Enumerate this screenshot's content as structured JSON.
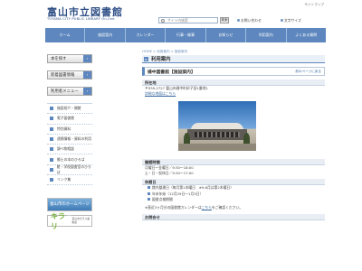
{
  "header": {
    "title": "富山市立図書館",
    "subtitle": "TOYAMA CITY PUBLIC LIBRARY On-line",
    "sitemap": "サイトマップ",
    "search_placeholder": "サイト内検索",
    "search_button": "検索",
    "link_contact": "お問い合わせ",
    "link_english": "文字サイズ"
  },
  "nav": [
    "ホーム",
    "施設案内",
    "カレンダー",
    "行事・催事",
    "お知らせ",
    "利用案内",
    "よくある質問"
  ],
  "breadcrumb": "HOME > 利用案内 > 施設案内",
  "sidebar": {
    "buttons": [
      {
        "label": "本を探す"
      },
      {
        "label": "新着図書情報"
      },
      {
        "label": "利用者メニュー"
      }
    ],
    "items": [
      "施設紹介・開館",
      "電子図書館",
      "特別資料",
      "遠隔情報・資料の利用",
      "調べ物相談",
      "郷土の本のひろば",
      "館・学校図書室のひろば",
      "リンク集"
    ],
    "banner1": "富山市のホームページへ",
    "banner2_mark": "キラリ",
    "banner2_text": "富山市ガラス美術館"
  },
  "main": {
    "page_title": "利用案内",
    "subtitle": "婦中図書館【施設案内】",
    "back_link": "前のページに戻る",
    "address_heading": "所在地",
    "address": "〒939-2727 富山市婦中町砂子田1番地1",
    "map_link": "詳細な地図はこちら",
    "hours_heading": "開館時間",
    "hours": [
      "月曜日～金曜日／9:30～18:00",
      "土・日・祝休日／9:30～17:00"
    ],
    "closed_heading": "休館日",
    "closed": [
      "館内整理日（毎月第1木曜日　※9,6月は第2木曜日）",
      "年末年始（12月29日～1月3日）",
      "図書点検期間"
    ],
    "note": "※直近3ヶ月分の図書館カレンダーは",
    "note_link": "こちら",
    "note_end": "をご確認ください。",
    "contact_heading": "お問合せ"
  }
}
